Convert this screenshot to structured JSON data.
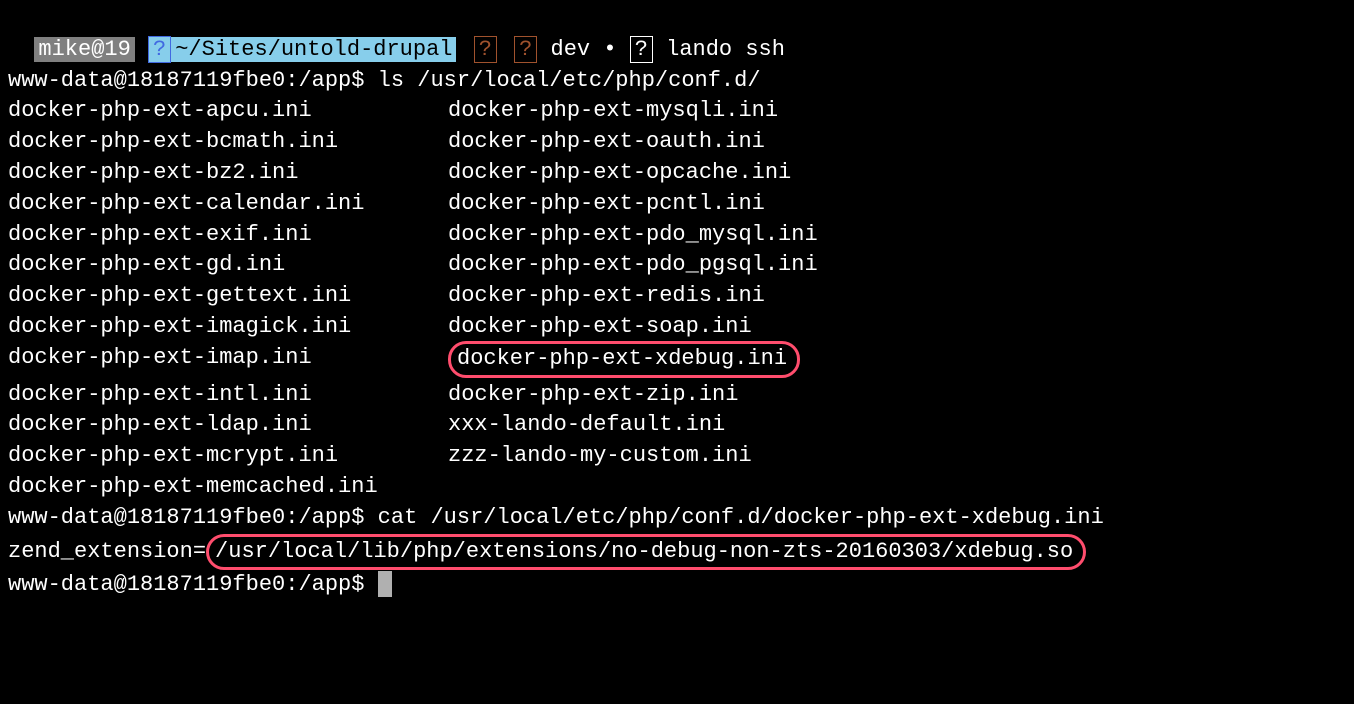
{
  "status": {
    "user": "mike@19",
    "icon1": "?",
    "path": "~/Sites/untold-drupal",
    "icon2": "?",
    "icon3": "?",
    "branch": "dev",
    "dot": "•",
    "icon4": "?",
    "cmd": "lando ssh"
  },
  "prompt1": "www-data@18187119fbe0:/app$ ",
  "cmd1": "ls /usr/local/etc/php/conf.d/",
  "files_col1": [
    "docker-php-ext-apcu.ini",
    "docker-php-ext-bcmath.ini",
    "docker-php-ext-bz2.ini",
    "docker-php-ext-calendar.ini",
    "docker-php-ext-exif.ini",
    "docker-php-ext-gd.ini",
    "docker-php-ext-gettext.ini",
    "docker-php-ext-imagick.ini",
    "docker-php-ext-imap.ini",
    "docker-php-ext-intl.ini",
    "docker-php-ext-ldap.ini",
    "docker-php-ext-mcrypt.ini",
    "docker-php-ext-memcached.ini"
  ],
  "files_col2": [
    "docker-php-ext-mysqli.ini",
    "docker-php-ext-oauth.ini",
    "docker-php-ext-opcache.ini",
    "docker-php-ext-pcntl.ini",
    "docker-php-ext-pdo_mysql.ini",
    "docker-php-ext-pdo_pgsql.ini",
    "docker-php-ext-redis.ini",
    "docker-php-ext-soap.ini",
    "docker-php-ext-xdebug.ini",
    "docker-php-ext-zip.ini",
    "xxx-lando-default.ini",
    "zzz-lando-my-custom.ini"
  ],
  "highlighted_index_col2": 8,
  "prompt2": "www-data@18187119fbe0:/app$ ",
  "cmd2": "cat /usr/local/etc/php/conf.d/docker-php-ext-xdebug.ini",
  "output_prefix": "zend_extension=",
  "output_highlighted": "/usr/local/lib/php/extensions/no-debug-non-zts-20160303/xdebug.so",
  "prompt3": "www-data@18187119fbe0:/app$ "
}
